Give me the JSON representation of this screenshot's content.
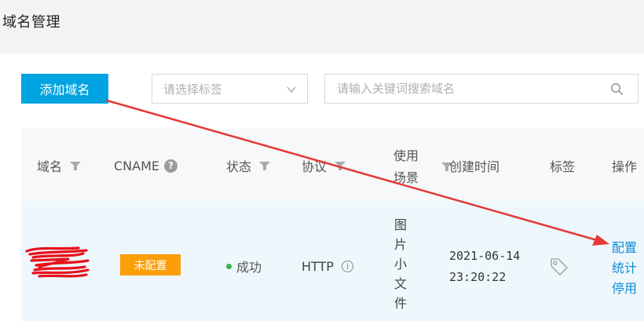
{
  "page": {
    "title": "域名管理"
  },
  "toolbar": {
    "add_domain_label": "添加域名",
    "tag_select_placeholder": "请选择标签",
    "search_placeholder": "请输入关键词搜索域名"
  },
  "table": {
    "headers": {
      "domain": "域名",
      "cname": "CNAME",
      "status": "状态",
      "protocol": "协议",
      "scene_line1": "使用",
      "scene_line2": "场景",
      "created": "创建时间",
      "tags": "标签",
      "actions": "操作"
    },
    "rows": [
      {
        "cname_badge": "未配置",
        "status": "成功",
        "protocol": "HTTP",
        "scene_chars": [
          "图",
          "片",
          "小",
          "文",
          "件"
        ],
        "created_date": "2021-06-14",
        "created_time": "23:20:22",
        "actions": {
          "configure": "配置",
          "stats": "统计",
          "disable": "停用"
        }
      }
    ]
  },
  "colors": {
    "primary": "#00a4e0",
    "badge_warning": "#fb9e08",
    "status_success": "#3eb24f",
    "link": "#0a8dd9",
    "annotation": "#e53935"
  },
  "icons": [
    "filter-icon",
    "help-icon",
    "info-icon",
    "chevron-down-icon",
    "search-icon",
    "tag-icon"
  ]
}
